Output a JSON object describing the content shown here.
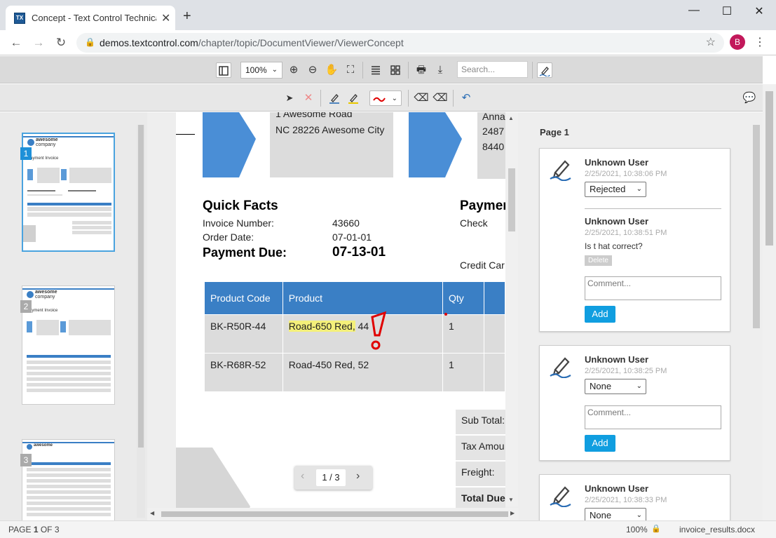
{
  "browser": {
    "tab_title": "Concept - Text Control Technical",
    "tab_favicon": "TX",
    "url_domain": "demos.textcontrol.com",
    "url_path": "/chapter/topic/DocumentViewer/ViewerConcept",
    "avatar_letter": "B"
  },
  "toolbar": {
    "zoom": "100%",
    "search_placeholder": "Search..."
  },
  "thumbnails": {
    "numbers": [
      "1",
      "2",
      "3"
    ],
    "company_top": "awesome",
    "company_bottom": "company",
    "title": "Payment Invoice"
  },
  "document": {
    "addr1_line1": "1 Awesome Road",
    "addr1_line2": "NC 28226 Awesome City",
    "addr2_line1": "Anna",
    "addr2_line2": "2487",
    "addr2_line3": "8440",
    "quick_facts_title": "Quick Facts",
    "invoice_number_label": "Invoice Number:",
    "invoice_number": "43660",
    "order_date_label": "Order Date:",
    "order_date": "07-01-01",
    "payment_due_label": "Payment Due:",
    "payment_due": "07-13-01",
    "payment_title": "Paymer",
    "payment_check": "Check",
    "payment_credit": "Credit Car",
    "table_headers": [
      "Product Code",
      "Product",
      "Qty"
    ],
    "rows": [
      {
        "code": "BK-R50R-44",
        "product_highlight": "Road-650 Red,",
        "product_rest": " 44",
        "qty": "1"
      },
      {
        "code": "BK-R68R-52",
        "product": "Road-450 Red, 52",
        "qty": "1"
      }
    ],
    "totals": [
      "Sub Total:",
      "Tax Amou",
      "Freight:",
      "Total Due"
    ]
  },
  "pager": {
    "label": "1 / 3"
  },
  "comments": {
    "page_label": "Page 1",
    "cards": [
      {
        "user": "Unknown User",
        "date": "2/25/2021, 10:38:06 PM",
        "status": "Rejected",
        "reply_user": "Unknown User",
        "reply_date": "2/25/2021, 10:38:51 PM",
        "reply_text": "Is t hat correct?",
        "delete_label": "Delete",
        "placeholder": "Comment...",
        "add_label": "Add"
      },
      {
        "user": "Unknown User",
        "date": "2/25/2021, 10:38:25 PM",
        "status": "None",
        "placeholder": "Comment...",
        "add_label": "Add"
      },
      {
        "user": "Unknown User",
        "date": "2/25/2021, 10:38:33 PM",
        "status": "None"
      }
    ]
  },
  "status": {
    "page_prefix": "PAGE",
    "page_current": "1",
    "page_suffix": "OF 3",
    "zoom": "100%",
    "filename": "invoice_results.docx"
  },
  "colors": {
    "accent": "#3a7fc5",
    "add_button": "#109ee0",
    "highlight": "#f4f07a",
    "ink": "#e00000"
  }
}
